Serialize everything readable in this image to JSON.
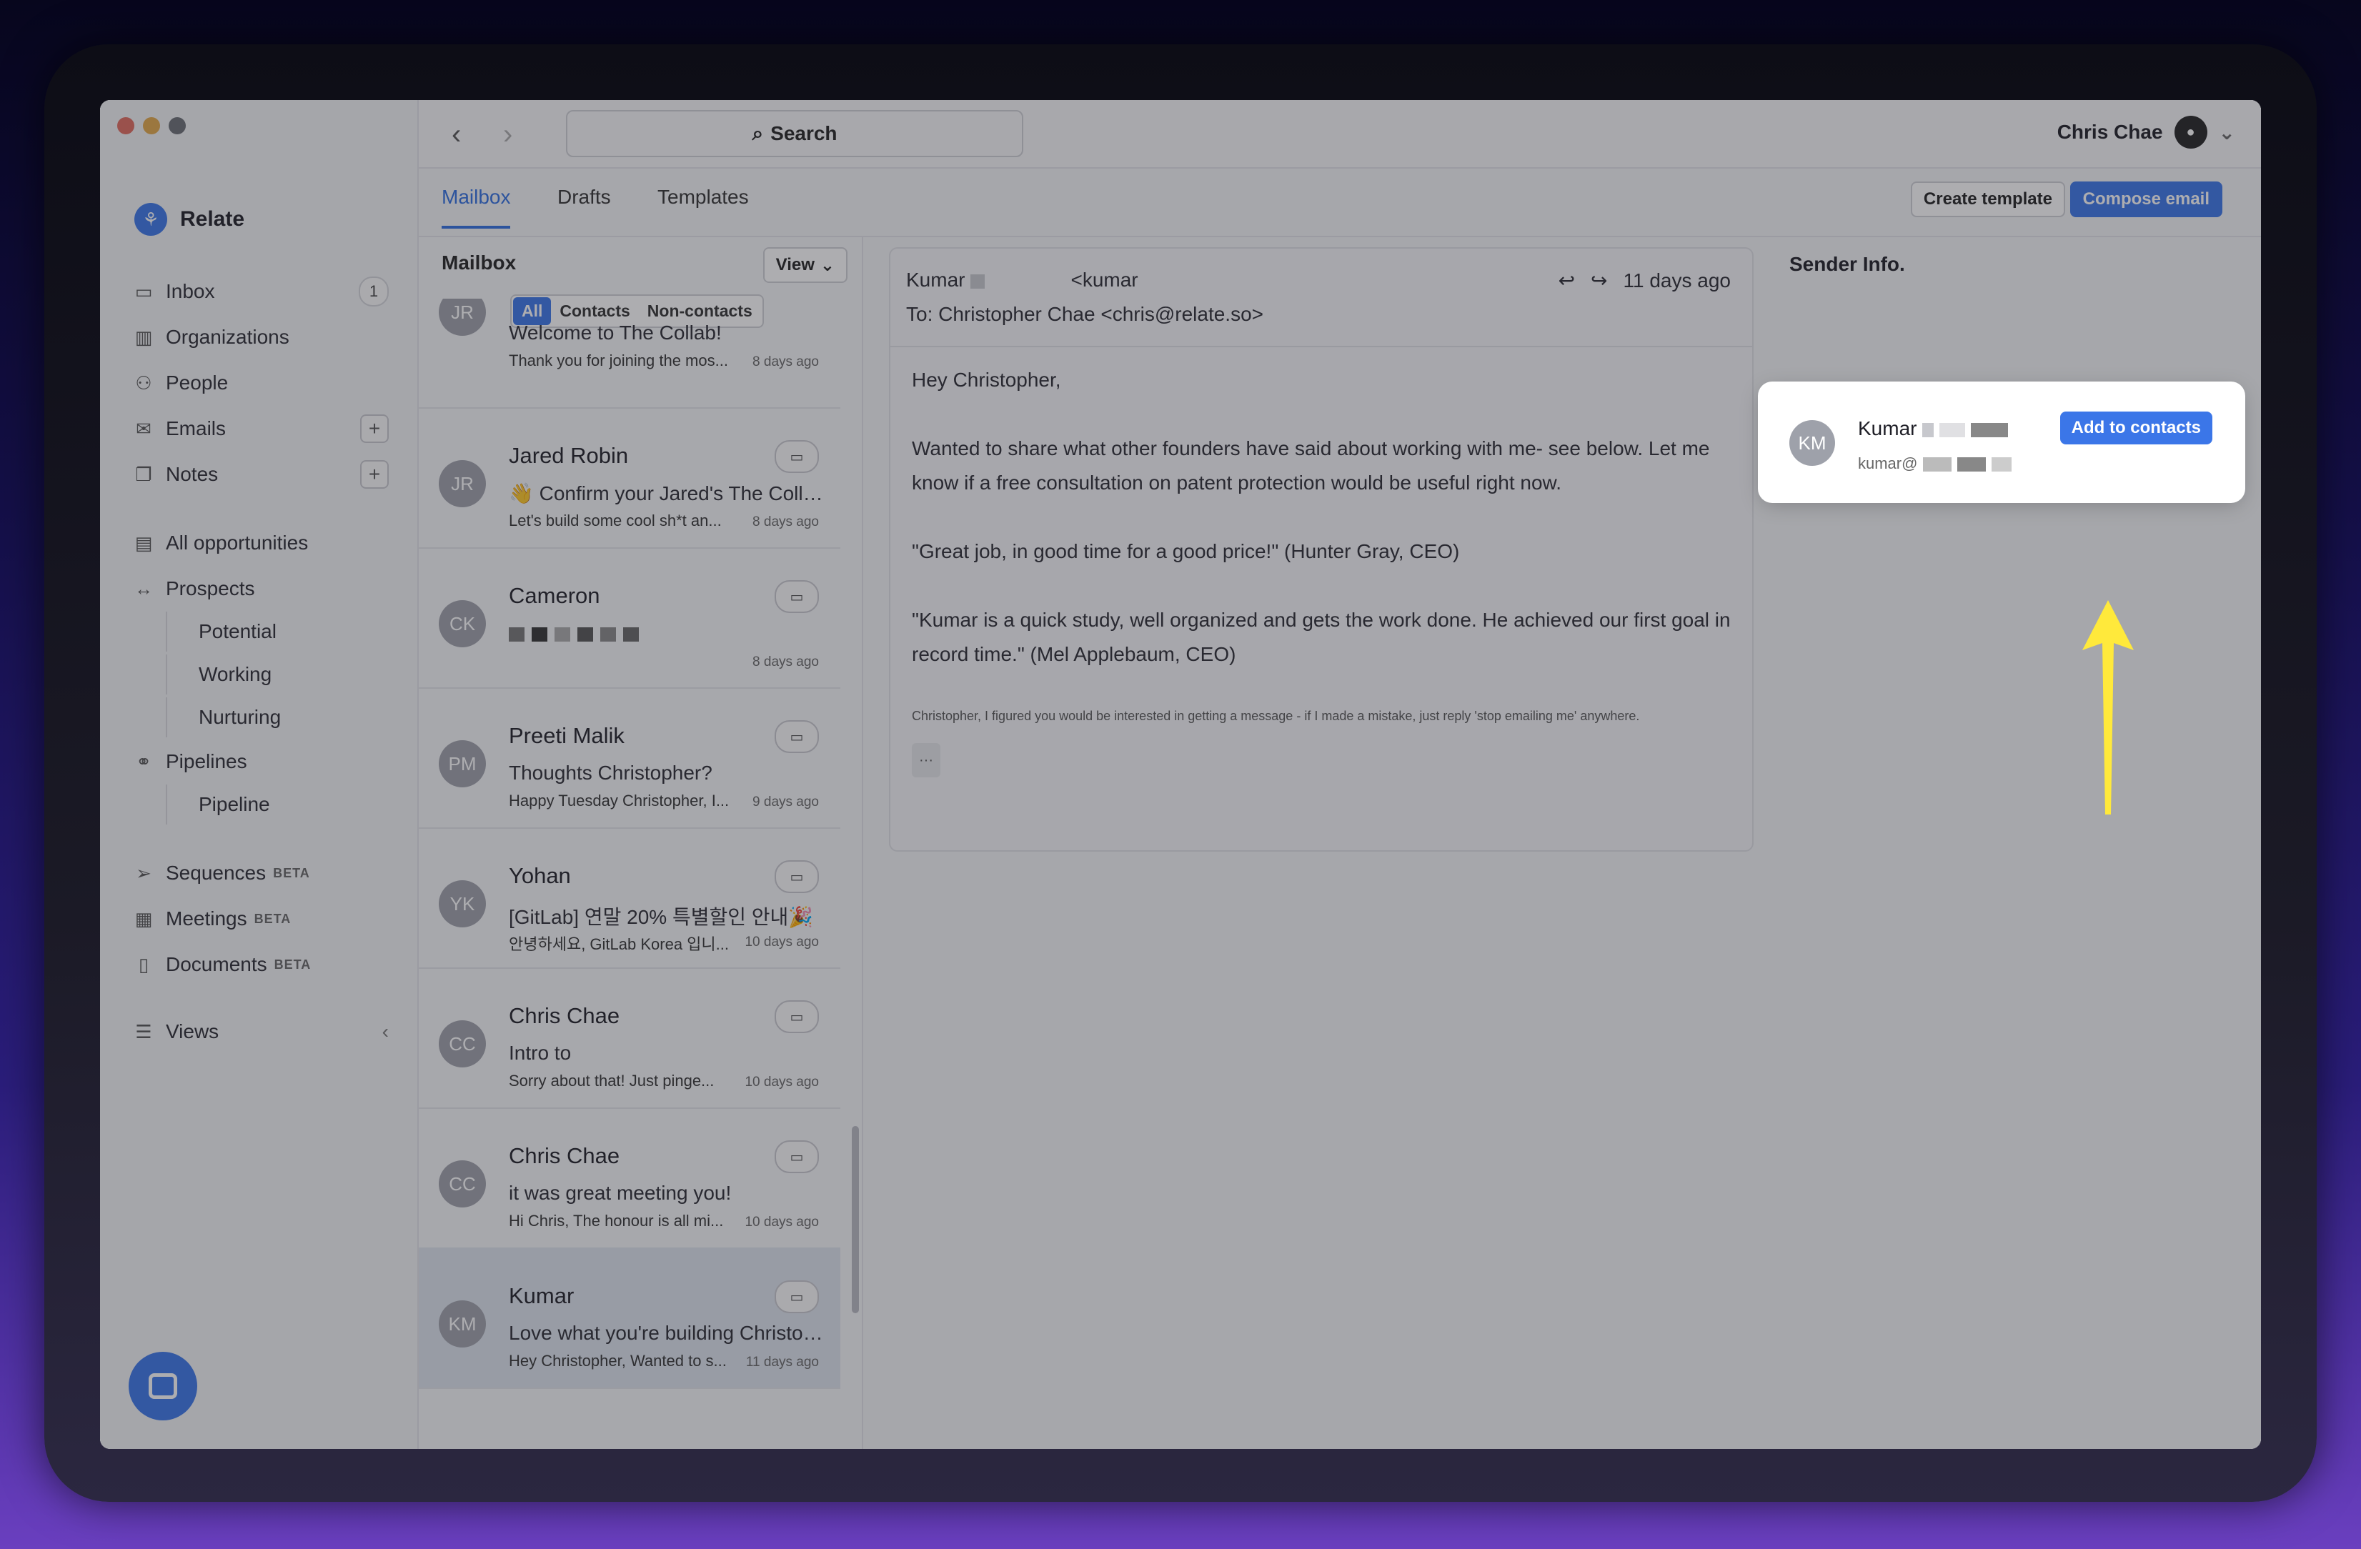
{
  "window": {
    "title": "Relate"
  },
  "sidebar": {
    "brand": "Relate",
    "items": [
      {
        "label": "Inbox",
        "count": "1"
      },
      {
        "label": "Organizations"
      },
      {
        "label": "People"
      },
      {
        "label": "Emails",
        "plus": "+"
      },
      {
        "label": "Notes",
        "plus": "+"
      },
      {
        "label": "All opportunities"
      },
      {
        "label": "Prospects"
      },
      {
        "label": "Potential"
      },
      {
        "label": "Working"
      },
      {
        "label": "Nurturing"
      },
      {
        "label": "Pipelines"
      },
      {
        "label": "Pipeline"
      },
      {
        "label": "Sequences",
        "beta": "BETA"
      },
      {
        "label": "Meetings",
        "beta": "BETA"
      },
      {
        "label": "Documents",
        "beta": "BETA"
      },
      {
        "label": "Views"
      }
    ]
  },
  "topbar": {
    "search": "Search",
    "user": "Chris Chae"
  },
  "tabs": {
    "mailbox": "Mailbox",
    "drafts": "Drafts",
    "templates": "Templates",
    "create_template": "Create template",
    "compose": "Compose email"
  },
  "list": {
    "title": "Mailbox",
    "view": "View",
    "filters": [
      "All",
      "Contacts",
      "Non-contacts"
    ],
    "items": [
      {
        "initials": "JR",
        "name": "",
        "subject": "Welcome to The Collab!",
        "preview": "Thank you for joining the mos...",
        "time": "8 days ago"
      },
      {
        "initials": "JR",
        "name": "Jared Robin",
        "subject": "👋 Confirm your Jared's The Colla...",
        "preview": "Let's build some cool sh*t an...",
        "time": "8 days ago"
      },
      {
        "initials": "CK",
        "name": "Cameron",
        "subject": "",
        "preview": "",
        "time": "8 days ago"
      },
      {
        "initials": "PM",
        "name": "Preeti Malik",
        "subject": "Thoughts Christopher?",
        "preview": "Happy Tuesday Christopher, I...",
        "time": "9 days ago"
      },
      {
        "initials": "YK",
        "name": "Yohan",
        "subject": "[GitLab] 연말 20% 특별할인 안내🎉",
        "preview": "안녕하세요, GitLab Korea 입니...",
        "time": "10 days ago"
      },
      {
        "initials": "CC",
        "name": "Chris Chae",
        "subject": "Intro to",
        "preview": "Sorry about that! Just pinge...",
        "time": "10 days ago"
      },
      {
        "initials": "CC",
        "name": "Chris Chae",
        "subject": "it was great meeting you!",
        "preview": "Hi Chris, The honour is all mi...",
        "time": "10 days ago"
      },
      {
        "initials": "KM",
        "name": "Kumar",
        "subject": "Love what you're building Christop...",
        "preview": "Hey Christopher, Wanted to s...",
        "time": "11 days ago"
      }
    ]
  },
  "reader": {
    "from": "Kumar",
    "from_email": "<kumar",
    "to": "To: Christopher Chae <chris@relate.so>",
    "time": "11 days ago",
    "body": [
      "Hey Christopher,",
      "Wanted to share what other founders have said about working with me- see below. Let me know if a free consultation on patent protection would be useful right now.",
      "\"Great job, in good time for a good price!\" (Hunter Gray, CEO)",
      "\"Kumar is a quick study, well organized and gets the work done. He achieved our first goal in record time.\" (Mel Applebaum, CEO)"
    ],
    "footer": "Christopher, I figured you would be interested in getting a message - if I made a mistake, just reply 'stop emailing me' anywhere.",
    "more": "···"
  },
  "sender": {
    "title": "Sender Info.",
    "initials": "KM",
    "name": "Kumar",
    "email": "kumar@",
    "add": "Add to contacts"
  },
  "colors": {
    "accent": "#3b76e8",
    "highlight": "#ffe93b"
  }
}
